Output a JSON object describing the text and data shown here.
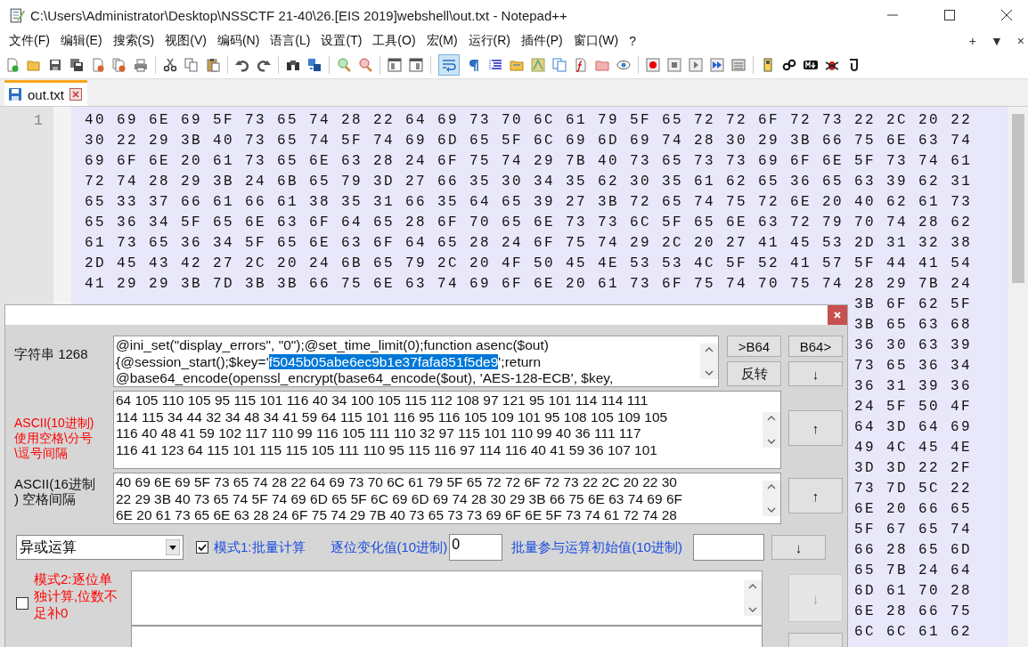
{
  "window": {
    "title": "C:\\Users\\Administrator\\Desktop\\NSSCTF 21-40\\26.[EIS 2019]webshell\\out.txt - Notepad++"
  },
  "menu": [
    "文件(F)",
    "编辑(E)",
    "搜索(S)",
    "视图(V)",
    "编码(N)",
    "语言(L)",
    "设置(T)",
    "工具(O)",
    "宏(M)",
    "运行(R)",
    "插件(P)",
    "窗口(W)",
    "?"
  ],
  "menu_controls": [
    "+",
    "▼",
    "×"
  ],
  "toolbar": {
    "word_wrap": {
      "on": true
    }
  },
  "tabs": [
    {
      "label": "out.txt",
      "selected": true
    }
  ],
  "editor": {
    "line_numbers": [
      "1"
    ],
    "lines": [
      "40 69 6E 69 5F 73 65 74 28 22 64 69 73 70 6C 61 79 5F 65 72 72 6F 72 73 22 2C 20 22",
      "30 22 29 3B 40 73 65 74 5F 74 69 6D 65 5F 6C 69 6D 69 74 28 30 29 3B 66 75 6E 63 74",
      "69 6F 6E 20 61 73 65 6E 63 28 24 6F 75 74 29 7B 40 73 65 73 73 69 6F 6E 5F 73 74 61",
      "72 74 28 29 3B 24 6B 65 79 3D 27 66 35 30 34 35 62 30 35 61 62 65 36 65 63 39 62 31",
      "65 33 37 66 61 66 61 38 35 31 66 35 64 65 39 27 3B 72 65 74 75 72 6E 20 40 62 61 73",
      "65 36 34 5F 65 6E 63 6F 64 65 28 6F 70 65 6E 73 73 6C 5F 65 6E 63 72 79 70 74 28 62",
      "61 73 65 36 34 5F 65 6E 63 6F 64 65 28 24 6F 75 74 29 2C 20 27 41 45 53 2D 31 32 38",
      "2D 45 43 42 27 2C 20 24 6B 65 79 2C 20 4F 50 45 4E 53 53 4C 5F 52 41 57 5F 44 41 54",
      "41 29 29 3B 7D 3B 3B 66 75 6E 63 74 69 6F 6E 20 61 73 6F 75 74 70 75 74 28 29 7B 24"
    ],
    "tail_lines": [
      "3B 6F 62 5F",
      "3B 65 63 68",
      "36 30 63 39",
      "73 65 36 34",
      "36 31 39 36",
      "24 5F 50 4F",
      "64 3D 64 69",
      "49 4C 45 4E",
      "3D 3D 22 2F",
      "73 7D 5C 22",
      "6E 20 66 65",
      "5F 67 65 74",
      "66 28 65 6D",
      "65 7B 24 64",
      "6D 61 70 28",
      "6E 28 66 75",
      "6C 6C 61 62"
    ]
  },
  "dialog": {
    "string_section": {
      "label": "字符串 1268",
      "lines": [
        [
          {
            "text": "@ini_set(\"display_errors\", \"0\");@set_time_limit(0);function asenc($out)",
            "selected": false
          }
        ],
        [
          {
            "text": "{@session_start();$key='",
            "selected": false
          },
          {
            "text": "f5045b05abe6ec9b1e37fafa851f5de9",
            "selected": true
          },
          {
            "text": "';return",
            "selected": false
          }
        ],
        [
          {
            "text": "@base64_encode(openssl_encrypt(base64_encode($out), 'AES-128-ECB', $key,",
            "selected": false
          }
        ]
      ],
      "buttons": [
        {
          "label": ">B64",
          "disabled": false
        },
        {
          "label": "B64>",
          "disabled": false
        },
        {
          "label": "反转",
          "disabled": false
        },
        {
          "label": "↓",
          "disabled": false
        }
      ]
    },
    "decimal_section": {
      "label": "ASCII(10进制)\n使用空格\\分号\n\\逗号间隔",
      "lines": [
        "64 105 110 105 95 115 101 116 40 34 100 105 115 112 108 97 121 95 101 114 114 111",
        "114 115 34 44 32 34 48 34 41 59 64 115 101 116 95 116 105 109 101 95 108 105 109 105",
        "116 40 48 41 59 102 117 110 99 116 105 111 110 32 97 115 101 110 99 40 36 111 117",
        "116 41 123 64 115 101 115 115 105 111 110 95 115 116 97 114 116 40 41 59 36 107 101"
      ],
      "button": {
        "label": "↑",
        "disabled": false
      }
    },
    "hex_section": {
      "label": "ASCII(16进制\n) 空格间隔",
      "lines": [
        "40 69 6E 69 5F 73 65 74 28 22 64 69 73 70 6C 61 79 5F 65 72 72 6F 72 73 22 2C 20 22 30",
        "22 29 3B 40 73 65 74 5F 74 69 6D 65 5F 6C 69 6D 69 74 28 30 29 3B 66 75 6E 63 74 69 6F",
        "6E 20 61 73 65 6E 63 28 24 6F 75 74 29 7B 40 73 65 73 73 69 6F 6E 5F 73 74 61 72 74 28"
      ],
      "button": {
        "label": "↑",
        "disabled": false
      }
    },
    "options": {
      "operation": "异或运算",
      "mode1": {
        "label": "模式1:批量计算",
        "checked": true
      },
      "step_label": "逐位变化值(10进制)",
      "step_value": "0",
      "initial_label": "批量参与运算初始值(10进制)",
      "button": {
        "label": "↓",
        "disabled": false
      }
    },
    "mode2": {
      "label": "模式2:逐位单独计算,位数不足补0",
      "checked": false,
      "button": {
        "label": "↓",
        "disabled": true
      }
    }
  }
}
